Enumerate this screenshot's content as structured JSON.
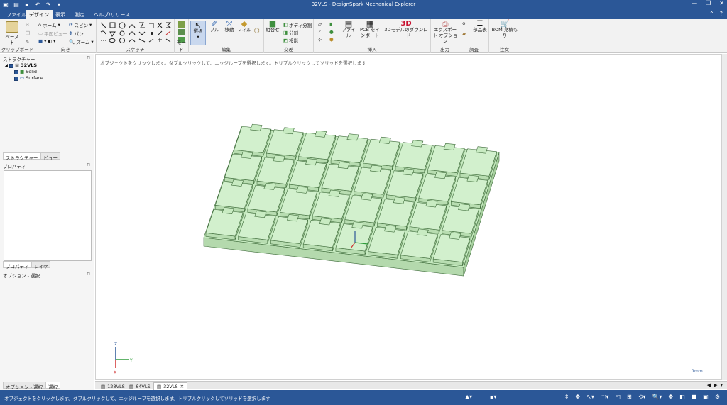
{
  "window": {
    "title": "32VLS - DesignSpark Mechanical Explorer"
  },
  "tabs": [
    "ファイル",
    "デザイン",
    "表示",
    "測定",
    "ヘルプ/リリース"
  ],
  "ribbon": {
    "clipboard": {
      "paste": "ペースト",
      "label": "クリップボード"
    },
    "orient": {
      "home": "ホーム",
      "plane_view": "平面ビュー",
      "spin": "スピン",
      "pan": "パン",
      "zoom": "ズーム",
      "label": "向き"
    },
    "sketch": {
      "label": "スケッチ"
    },
    "mode": {
      "label": "モード"
    },
    "edit": {
      "select": "選択",
      "pull": "プル",
      "move": "移動",
      "fill": "フィル",
      "label": "編集"
    },
    "intersect": {
      "combine": "組合せ",
      "split_body": "ボディ分割",
      "split": "分割",
      "project": "投影",
      "label": "交差"
    },
    "insert": {
      "file": "ファイル",
      "pcb": "PCB をインポート",
      "download": "3Dモデルのダウンロード",
      "label": "挿入"
    },
    "output": {
      "export": "エクスポート オプション",
      "label": "出力"
    },
    "investigate": {
      "parts": "部品表",
      "label": "調査"
    },
    "order": {
      "bom": "BOM 見積もり",
      "label": "注文"
    }
  },
  "structure": {
    "header": "ストラクチャー",
    "root": "32VLS",
    "items": [
      "Solid",
      "Surface"
    ],
    "tabs": [
      "ストラクチャー",
      "ビュー"
    ]
  },
  "properties": {
    "header": "プロパティ",
    "tabs": [
      "プロパティ",
      "レイヤ"
    ]
  },
  "options": {
    "header": "オプション - 選択",
    "tabs": [
      "オプション - 選択",
      "選択"
    ]
  },
  "viewport": {
    "hint": "オブジェクトをクリックします。ダブルクリックして、エッジループを選択します。トリプルクリックしてソリッドを選択します",
    "scale": "1mm",
    "axes": {
      "z": "Z",
      "y": "Y",
      "x": "X"
    }
  },
  "docs": [
    "128VLS",
    "64VLS",
    "32VLS"
  ],
  "status": {
    "message": "オブジェクトをクリックします。ダブルクリックして、エッジループを選択します。トリプルクリックしてソリッドを選択します"
  },
  "colors": {
    "brand": "#2b5797",
    "model_fill": "#c6eac0",
    "model_edge": "#3e6b3a"
  }
}
